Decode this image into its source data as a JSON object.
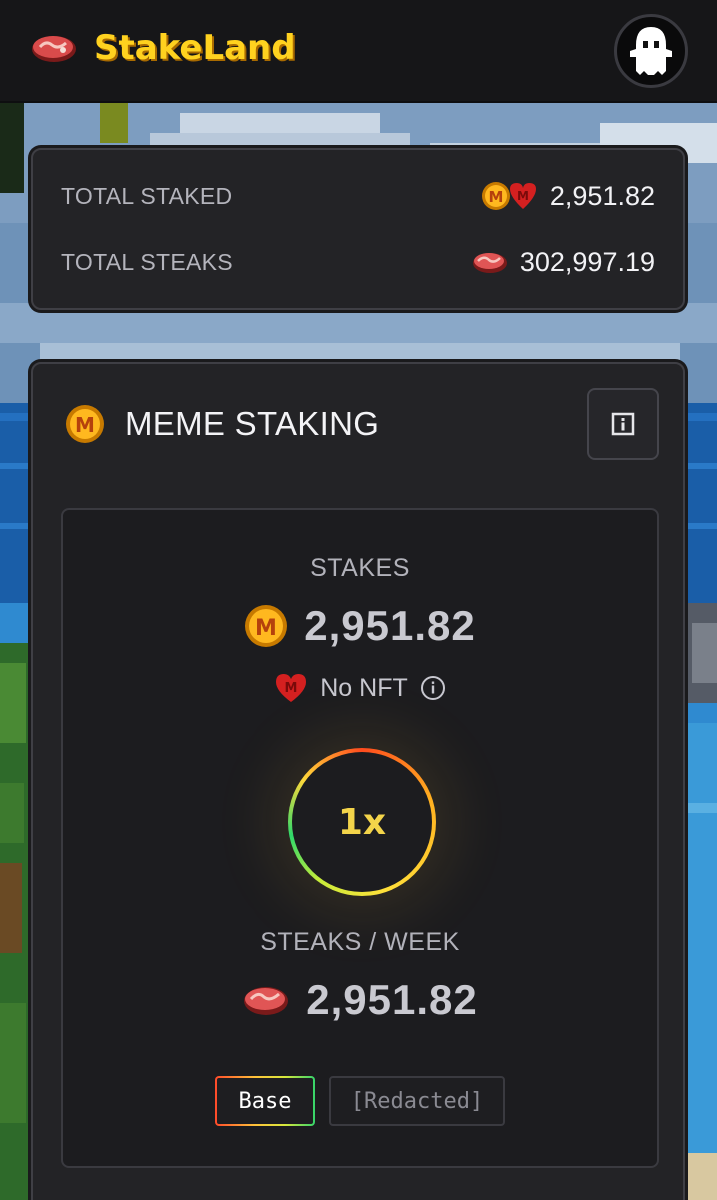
{
  "header": {
    "brand": "StakeLand",
    "logo_icon": "steak-icon",
    "avatar_icon": "ghost-avatar-icon"
  },
  "stats": {
    "total_staked_label": "TOTAL STAKED",
    "total_staked_value": "2,951.82",
    "total_steaks_label": "TOTAL STEAKS",
    "total_steaks_value": "302,997.19"
  },
  "staking": {
    "title": "MEME STAKING",
    "stakes_label": "STAKES",
    "stakes_value": "2,951.82",
    "nft_status": "No NFT",
    "multiplier": "1x",
    "steaks_per_week_label": "STEAKS / WEEK",
    "steaks_per_week_value": "2,951.82",
    "tabs": [
      {
        "label": "Base",
        "active": true
      },
      {
        "label": "[Redacted]",
        "active": false
      }
    ]
  },
  "colors": {
    "brand_yellow": "#ffd21f",
    "panel_bg": "#232326",
    "multiplier_text": "#f3d44a"
  }
}
